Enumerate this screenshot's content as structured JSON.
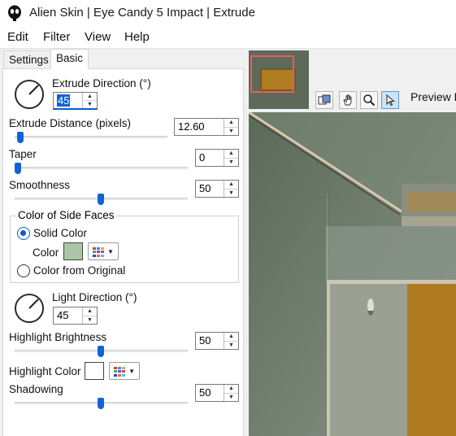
{
  "window": {
    "title": "Alien Skin | Eye Candy 5 Impact | Extrude"
  },
  "menu": {
    "items": [
      "Edit",
      "Filter",
      "View",
      "Help"
    ]
  },
  "tabs": {
    "settings": "Settings",
    "basic": "Basic"
  },
  "controls": {
    "extrude_direction": {
      "label": "Extrude Direction (°)",
      "value": "45",
      "angle": 45
    },
    "extrude_distance": {
      "label": "Extrude Distance (pixels)",
      "value": "12.60",
      "slider": 0.05
    },
    "taper": {
      "label": "Taper",
      "value": "0",
      "slider": 0.0
    },
    "smoothness": {
      "label": "Smoothness",
      "value": "50",
      "slider": 0.5
    },
    "side_faces": {
      "title": "Color of Side Faces",
      "solid_color": "Solid Color",
      "color_label": "Color",
      "color_value": "#a9c7a4",
      "from_original": "Color from Original",
      "selected": "solid_color"
    },
    "light_direction": {
      "label": "Light Direction (°)",
      "value": "45",
      "angle": 45
    },
    "highlight_brightness": {
      "label": "Highlight Brightness",
      "value": "50",
      "slider": 0.5
    },
    "highlight_color": {
      "label": "Highlight Color",
      "color_value": "#ffffff"
    },
    "shadowing": {
      "label": "Shadowing",
      "value": "50",
      "slider": 0.5
    }
  },
  "preview": {
    "label": "Preview B",
    "tools": [
      "compare-icon",
      "hand-icon",
      "zoom-icon",
      "arrow-select-icon"
    ],
    "active_tool": "arrow-select-icon"
  },
  "colors": {
    "accent": "#0a5bd0",
    "thumb_frame": "#e85c5c"
  }
}
